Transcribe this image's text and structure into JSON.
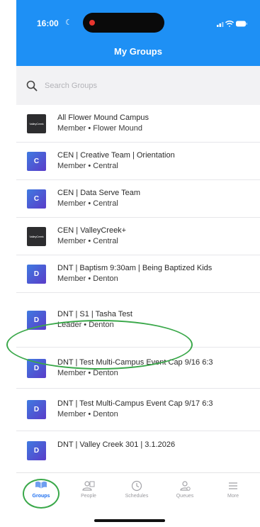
{
  "status_bar": {
    "time": "16:00",
    "moon_glyph": "☾"
  },
  "header": {
    "title": "My Groups"
  },
  "search": {
    "placeholder": "Search Groups"
  },
  "groups": [
    {
      "initial": "",
      "logo_text": "ValleyCreek",
      "title": "All Flower Mound Campus",
      "subtitle": "Member • Flower Mound"
    },
    {
      "initial": "C",
      "title": "CEN | Creative Team | Orientation",
      "subtitle": "Member • Central"
    },
    {
      "initial": "C",
      "title": "CEN | Data Serve Team",
      "subtitle": "Member • Central"
    },
    {
      "initial": "",
      "logo_text": "ValleyCreek",
      "title": "CEN | ValleyCreek+",
      "subtitle": "Member • Central"
    },
    {
      "initial": "D",
      "title": "DNT | Baptism 9:30am | Being Baptized Kids",
      "subtitle": "Member • Denton"
    },
    {
      "initial": "D",
      "title": "DNT | S1 | Tasha Test",
      "subtitle": "Leader • Denton"
    },
    {
      "initial": "D",
      "title": "DNT | Test Multi-Campus Event Cap 9/16 6:3",
      "subtitle": "Member • Denton"
    },
    {
      "initial": "D",
      "title": "DNT | Test Multi-Campus Event Cap 9/17 6:3",
      "subtitle": "Member • Denton"
    },
    {
      "initial": "D",
      "title": "DNT | Valley Creek 301 | 3.1.2026",
      "subtitle": ""
    }
  ],
  "tabs": [
    {
      "label": "Groups",
      "icon": "groups-icon",
      "active": true
    },
    {
      "label": "People",
      "icon": "people-icon",
      "active": false
    },
    {
      "label": "Schedules",
      "icon": "clock-icon",
      "active": false
    },
    {
      "label": "Queues",
      "icon": "queue-person-icon",
      "active": false
    },
    {
      "label": "More",
      "icon": "menu-icon",
      "active": false
    }
  ],
  "colors": {
    "header_blue": "#1e90f5",
    "active_tab": "#1e6ff0",
    "annotation_green": "#3aa84a"
  }
}
